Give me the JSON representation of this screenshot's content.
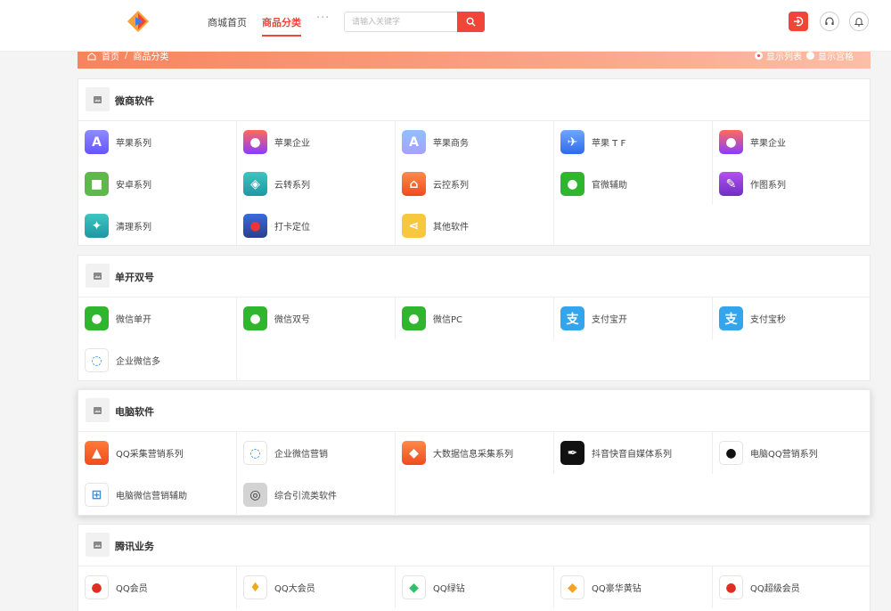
{
  "header": {
    "nav": [
      {
        "label": "商城首页"
      },
      {
        "label": "商品分类"
      }
    ],
    "more": "···",
    "search": {
      "placeholder": "请输入关键字"
    }
  },
  "banner": {
    "crumb_home": "首页",
    "crumb_sep": "/",
    "crumb_current": "商品分类",
    "view_list": "显示列表",
    "view_grid": "显示宫格"
  },
  "sections": [
    {
      "title": "微商软件",
      "items": [
        {
          "label": "苹果系列",
          "icon": "app-store-icon"
        },
        {
          "label": "苹果企业",
          "icon": "apple-icon"
        },
        {
          "label": "苹果商务",
          "icon": "app-store-light-icon"
        },
        {
          "label": "苹果 T F",
          "icon": "testflight-icon"
        },
        {
          "label": "苹果企业",
          "icon": "apple-icon"
        },
        {
          "label": "安卓系列",
          "icon": "android-icon"
        },
        {
          "label": "云转系列",
          "icon": "cloud-forward-icon"
        },
        {
          "label": "云控系列",
          "icon": "cloud-control-icon"
        },
        {
          "label": "官微辅助",
          "icon": "wechat-icon"
        },
        {
          "label": "作图系列",
          "icon": "ps-icon"
        },
        {
          "label": "清理系列",
          "icon": "broom-icon"
        },
        {
          "label": "打卡定位",
          "icon": "map-pin-icon"
        },
        {
          "label": "其他软件",
          "icon": "share-icon"
        }
      ]
    },
    {
      "title": "单开双号",
      "items": [
        {
          "label": "微信单开",
          "icon": "wechat-icon"
        },
        {
          "label": "微信双号",
          "icon": "wechat-icon"
        },
        {
          "label": "微信PC",
          "icon": "wechat-icon"
        },
        {
          "label": "支付宝开",
          "icon": "alipay-icon"
        },
        {
          "label": "支付宝秒",
          "icon": "alipay-icon"
        },
        {
          "label": "企业微信多",
          "icon": "work-wechat-icon"
        }
      ]
    },
    {
      "title": "电脑软件",
      "items": [
        {
          "label": "QQ采集营销系列",
          "icon": "qq-red-icon"
        },
        {
          "label": "企业微信营销",
          "icon": "work-wechat-icon"
        },
        {
          "label": "大数据信息采集系列",
          "icon": "data-badge-icon"
        },
        {
          "label": "抖音快音自媒体系列",
          "icon": "calligraphy-icon"
        },
        {
          "label": "电脑QQ营销系列",
          "icon": "qq-penguin-icon"
        },
        {
          "label": "电脑微信营销辅助",
          "icon": "windows-icon"
        },
        {
          "label": "综合引流类软件",
          "icon": "qu-icon"
        }
      ]
    },
    {
      "title": "腾讯业务",
      "items": [
        {
          "label": "QQ会员",
          "icon": "qq-member-icon"
        },
        {
          "label": "QQ大会员",
          "icon": "qq-big-member-icon"
        },
        {
          "label": "QQ绿钻",
          "icon": "green-diamond-icon"
        },
        {
          "label": "QQ豪华黄钻",
          "icon": "yellow-diamond-icon"
        },
        {
          "label": "QQ超级会员",
          "icon": "qq-super-member-icon"
        }
      ]
    }
  ]
}
